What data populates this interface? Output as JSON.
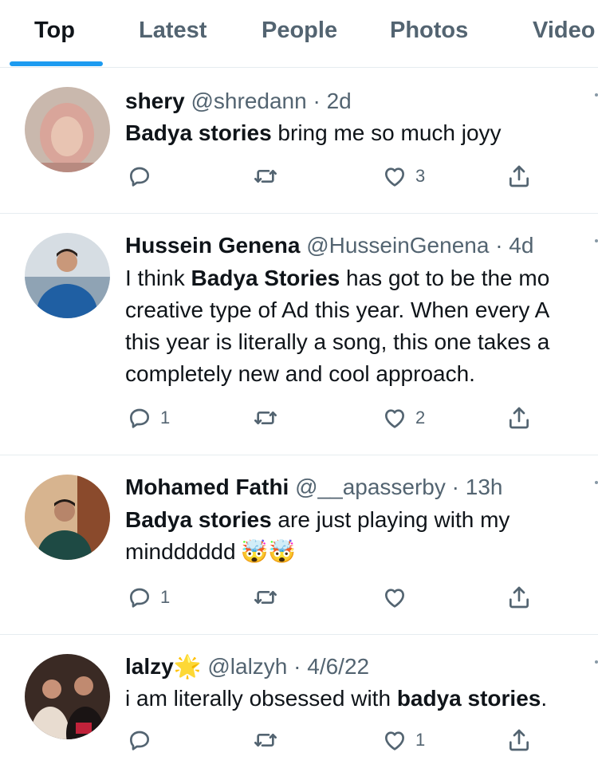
{
  "tabs": [
    "Top",
    "Latest",
    "People",
    "Photos",
    "Video"
  ],
  "tweets": [
    {
      "name": "shery",
      "handle": "@shredann",
      "time": "· 2d",
      "segments": [
        {
          "bold": true,
          "text": "Badya stories"
        },
        {
          "bold": false,
          "text": " bring me so much joyy"
        }
      ],
      "reply_count": "",
      "retweet_count": "",
      "like_count": "3"
    },
    {
      "name": "Hussein Genena",
      "handle": "@HusseinGenena",
      "time": "· 4d",
      "lines": [
        [
          {
            "bold": false,
            "text": "I think "
          },
          {
            "bold": true,
            "text": "Badya Stories"
          },
          {
            "bold": false,
            "text": " has got to be the mo"
          }
        ],
        [
          {
            "bold": false,
            "text": "creative type of Ad this year. When every A"
          }
        ],
        [
          {
            "bold": false,
            "text": "this year is literally a song, this one takes a"
          }
        ],
        [
          {
            "bold": false,
            "text": "completely new and cool approach."
          }
        ]
      ],
      "reply_count": "1",
      "retweet_count": "",
      "like_count": "2"
    },
    {
      "name": "Mohamed Fathi",
      "handle": "@__apasserby",
      "time": "· 13h",
      "lines": [
        [
          {
            "bold": true,
            "text": "Badya stories"
          },
          {
            "bold": false,
            "text": " are just playing with my"
          }
        ],
        [
          {
            "bold": false,
            "text": "mindddddd"
          }
        ]
      ],
      "emoji": "🤯🤯",
      "reply_count": "1",
      "retweet_count": "",
      "like_count": ""
    },
    {
      "name": "lalzy",
      "name_emoji": "🌟",
      "handle": "@lalzyh",
      "time": "· 4/6/22",
      "segments": [
        {
          "bold": false,
          "text": "i am literally obsessed with "
        },
        {
          "bold": true,
          "text": "badya stories"
        },
        {
          "bold": false,
          "text": "."
        }
      ],
      "reply_count": "",
      "retweet_count": "",
      "like_count": "1"
    }
  ],
  "icons": {
    "reply": "reply-icon",
    "retweet": "retweet-icon",
    "like": "heart-icon",
    "share": "share-icon"
  },
  "colors": {
    "accent": "#1d9bf0",
    "text": "#0f1419",
    "muted": "#536471"
  }
}
